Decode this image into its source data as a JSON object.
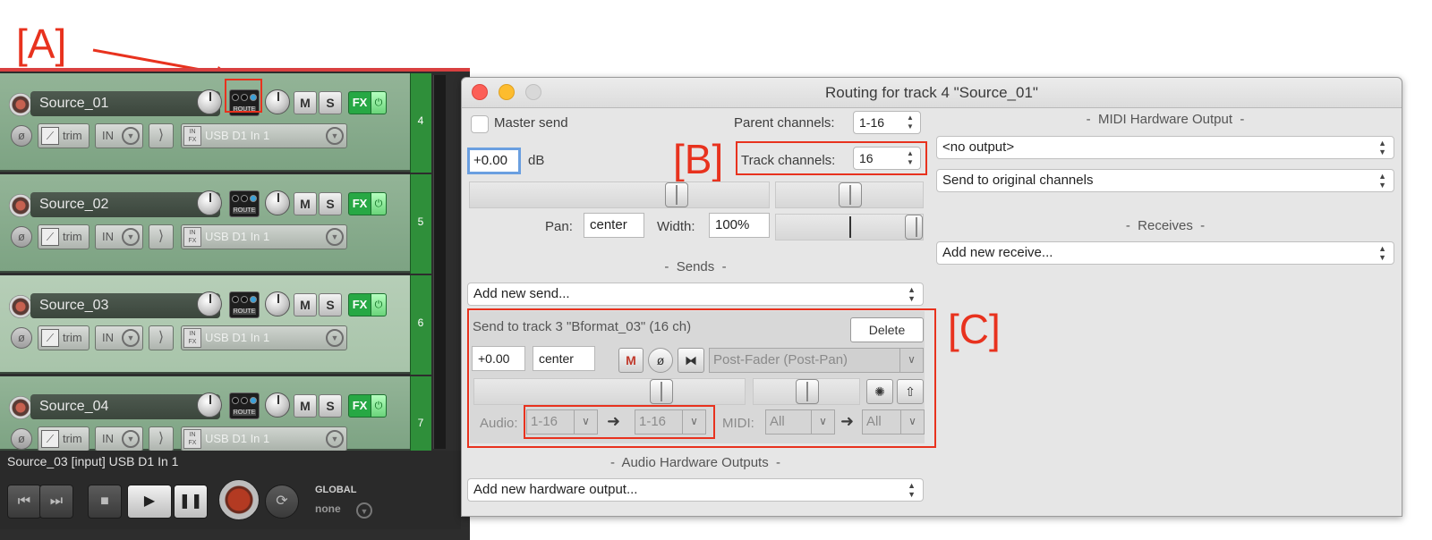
{
  "annotations": {
    "a": "[A]",
    "b": "[B]",
    "c": "[C]"
  },
  "colors": {
    "annotation_red": "#e8321e",
    "track_green": "#93b497",
    "meter_green": "#2f8f3a",
    "fx_green": "#27a844"
  },
  "tracks": [
    {
      "name": "Source_01",
      "number": "4",
      "input": "USB D1 In 1",
      "route_label": "ROUTE",
      "mute": "M",
      "solo": "S",
      "fx": "FX",
      "trim": "trim",
      "in_label": "IN",
      "power_icon": "power-icon"
    },
    {
      "name": "Source_02",
      "number": "5",
      "input": "USB D1 In 1",
      "route_label": "ROUTE",
      "mute": "M",
      "solo": "S",
      "fx": "FX",
      "trim": "trim",
      "in_label": "IN"
    },
    {
      "name": "Source_03",
      "number": "6",
      "input": "USB D1 In 1",
      "route_label": "ROUTE",
      "mute": "M",
      "solo": "S",
      "fx": "FX",
      "trim": "trim",
      "in_label": "IN"
    },
    {
      "name": "Source_04",
      "number": "7",
      "input": "USB D1 In 1",
      "route_label": "ROUTE",
      "mute": "M",
      "solo": "S",
      "fx": "FX",
      "trim": "trim",
      "in_label": "IN"
    }
  ],
  "status_line": "Source_03 [input] USB D1 In 1",
  "transport": {
    "global_label": "GLOBAL",
    "global_value": "none"
  },
  "routing": {
    "title": "Routing for track 4 \"Source_01\"",
    "master_send_label": "Master send",
    "parent_channels_label": "Parent channels:",
    "parent_channels_value": "1-16",
    "track_channels_label": "Track channels:",
    "track_channels_value": "16",
    "volume_value": "+0.00",
    "db_label": "dB",
    "pan_label": "Pan:",
    "pan_value": "center",
    "width_label": "Width:",
    "width_value": "100%",
    "sends_header": "-  Sends  -",
    "add_send": "Add new send...",
    "send": {
      "title": "Send to track 3 \"Bformat_03\" (16 ch)",
      "delete_label": "Delete",
      "volume": "+0.00",
      "pan": "center",
      "mute_label": "M",
      "mode": "Post-Fader (Post-Pan)",
      "audio_label": "Audio:",
      "audio_src": "1-16",
      "audio_dst": "1-16",
      "midi_label": "MIDI:",
      "midi_src": "All",
      "midi_dst": "All"
    },
    "audio_hw_header": "-  Audio Hardware Outputs  -",
    "add_hw_output": "Add new hardware output...",
    "midi_hw_header": "-  MIDI Hardware Output  -",
    "midi_output": "<no output>",
    "midi_channels": "Send to original channels",
    "receives_header": "-  Receives  -",
    "add_receive": "Add new receive..."
  }
}
